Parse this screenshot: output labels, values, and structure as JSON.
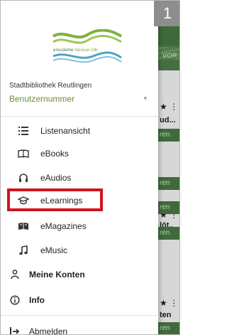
{
  "step_badge": "1",
  "logo": {
    "part1": "eAusleihe",
    "part2": "Neckar-Alb"
  },
  "drawer": {
    "library_name": "Stadtbibliothek Reutlingen",
    "user_number_label": "Benutzernummer",
    "menu": [
      {
        "label": "Listenansicht",
        "icon": "list-icon"
      },
      {
        "label": "eBooks",
        "icon": "book-icon"
      },
      {
        "label": "eAudios",
        "icon": "headphones-icon"
      },
      {
        "label": "eLearnings",
        "icon": "graduation-cap-icon",
        "highlighted": true
      },
      {
        "label": "eMagazines",
        "icon": "magazines-icon"
      },
      {
        "label": "eMusic",
        "icon": "music-note-icon"
      }
    ],
    "sections": [
      {
        "label": "Meine Konten",
        "icon": "person-icon"
      },
      {
        "label": "Info",
        "icon": "info-icon"
      }
    ],
    "logout_label": "Abmelden"
  },
  "background": {
    "tab_text": "VOR",
    "snippets": [
      "ud...",
      "ren",
      "ren",
      "ren",
      "löt..",
      "ren",
      "ten",
      "ren"
    ]
  },
  "colors": {
    "toolbar": "#3e6a3a",
    "accent_green": "#6c8f2f",
    "highlight_red": "#d2131f",
    "badge": "#8d8d8d"
  }
}
